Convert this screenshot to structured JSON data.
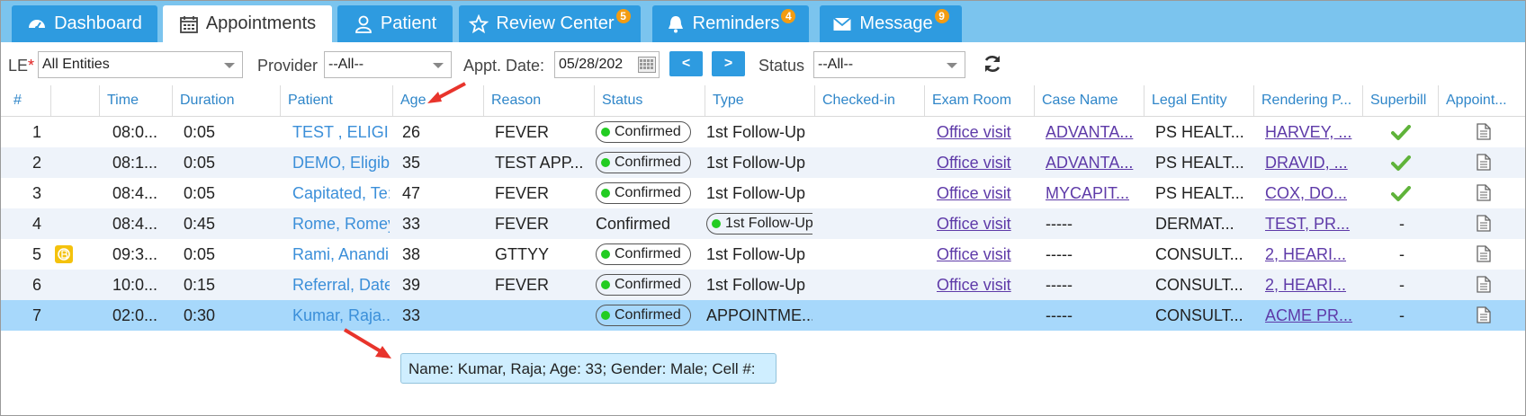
{
  "tabs": [
    {
      "label": "Dashboard",
      "icon": "dashboard-icon"
    },
    {
      "label": "Appointments",
      "icon": "calendar-icon",
      "active": true
    },
    {
      "label": "Patient",
      "icon": "user-icon"
    },
    {
      "label": "Review Center",
      "icon": "star-icon",
      "badge": "5"
    },
    {
      "label": "Reminders",
      "icon": "bell-icon",
      "badge": "4"
    },
    {
      "label": "Message",
      "icon": "envelope-icon",
      "badge": "9"
    }
  ],
  "filters": {
    "le_label": "LE",
    "le_required": "*",
    "le_value": "All Entities",
    "provider_label": "Provider",
    "provider_value": "--All--",
    "date_label": "Appt. Date:",
    "date_value": "05/28/202",
    "prev": "<",
    "next": ">",
    "status_label": "Status",
    "status_value": "--All--"
  },
  "columns": [
    "#",
    "",
    "Time",
    "Duration",
    "Patient",
    "Age",
    "Reason",
    "Status",
    "Type",
    "Checked-in",
    "Exam Room",
    "Case Name",
    "Legal Entity",
    "Rendering P...",
    "Superbill",
    "Appoint..."
  ],
  "rows": [
    {
      "num": "1",
      "time": "08:0...",
      "duration": "0:05",
      "patient": "TEST , ELIGIBI",
      "age": "26",
      "reason": "FEVER",
      "status": "Confirmed",
      "status_pill": true,
      "type": "1st Follow-Up",
      "type_pill": false,
      "exam": "Office visit",
      "case": "ADVANTA...",
      "case_link": true,
      "entity": "PS HEALT...",
      "rendering": "HARVEY, ...",
      "superbill": "check"
    },
    {
      "num": "2",
      "time": "08:1...",
      "duration": "0:05",
      "patient": "DEMO, Eligibi",
      "age": "35",
      "reason": "TEST APP...",
      "status": "Confirmed",
      "status_pill": true,
      "type": "1st Follow-Up",
      "type_pill": false,
      "exam": "Office visit",
      "case": "ADVANTA...",
      "case_link": true,
      "entity": "PS HEALT...",
      "rendering": "DRAVID, ...",
      "superbill": "check"
    },
    {
      "num": "3",
      "time": "08:4...",
      "duration": "0:05",
      "patient": "Capitated, Te:",
      "age": "47",
      "reason": "FEVER",
      "status": "Confirmed",
      "status_pill": true,
      "type": "1st Follow-Up",
      "type_pill": false,
      "exam": "Office visit",
      "case": "MYCAPIT...",
      "case_link": true,
      "entity": "PS HEALT...",
      "rendering": "COX, DO...",
      "superbill": "check"
    },
    {
      "num": "4",
      "time": "08:4...",
      "duration": "0:45",
      "patient": "Rome, Romey",
      "age": "33",
      "reason": "FEVER",
      "status": "Confirmed",
      "status_pill": false,
      "type": "1st Follow-Up",
      "type_pill": true,
      "exam": "Office visit",
      "case": "-----",
      "case_link": false,
      "entity": "DERMAT...",
      "rendering": "TEST, PR...",
      "superbill": "-"
    },
    {
      "num": "5",
      "time": "09:3...",
      "duration": "0:05",
      "patient": "Rami, Anandi",
      "age": "38",
      "reason": "GTTYY",
      "status": "Confirmed",
      "status_pill": true,
      "type": "1st Follow-Up",
      "type_pill": false,
      "exam": "Office visit",
      "case": "-----",
      "case_link": false,
      "entity": "CONSULT...",
      "rendering": "2, HEARI...",
      "superbill": "-",
      "coin": true
    },
    {
      "num": "6",
      "time": "10:0...",
      "duration": "0:15",
      "patient": "Referral, Date",
      "age": "39",
      "reason": "FEVER",
      "status": "Confirmed",
      "status_pill": true,
      "type": "1st Follow-Up",
      "type_pill": false,
      "exam": "Office visit",
      "case": "-----",
      "case_link": false,
      "entity": "CONSULT...",
      "rendering": "2, HEARI...",
      "superbill": "-"
    },
    {
      "num": "7",
      "time": "02:0...",
      "duration": "0:30",
      "patient": "Kumar, Raja...",
      "age": "33",
      "reason": "",
      "status": "Confirmed",
      "status_pill": true,
      "type": "APPOINTME...",
      "type_pill": false,
      "exam": "",
      "case": "-----",
      "case_link": false,
      "entity": "CONSULT...",
      "rendering": "ACME PR...",
      "superbill": "-"
    }
  ],
  "tooltip": "Name: Kumar, Raja; Age: 33; Gender: Male; Cell #:",
  "colors": {
    "tab": "#2e9be0",
    "tabbar": "#7bc4ee",
    "badge": "#f39c12",
    "selected_row": "#a7d8fb",
    "alt_row": "#eef3fa",
    "link": "#3b8fd9",
    "visited_link": "#5e3aa8",
    "arrow": "#e8342c",
    "confirmed_dot": "#22cc22"
  }
}
